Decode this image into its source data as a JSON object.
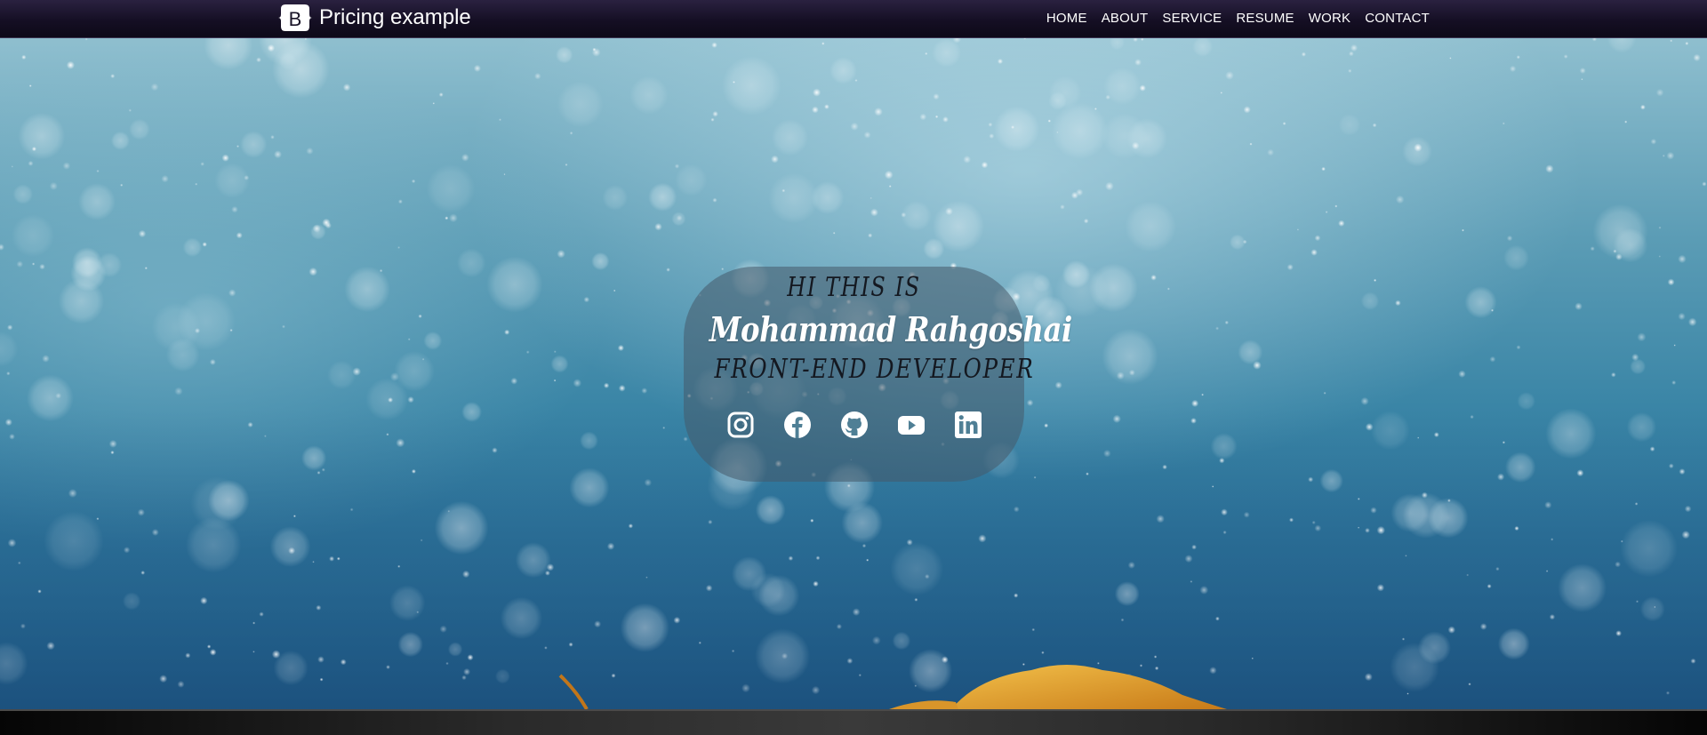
{
  "navbar": {
    "brand_text": "Pricing example",
    "brand_logo_letter": "B",
    "links": [
      {
        "label": "HOME"
      },
      {
        "label": "ABOUT"
      },
      {
        "label": "SERVICE"
      },
      {
        "label": "RESUME"
      },
      {
        "label": "WORK"
      },
      {
        "label": "CONTACT"
      }
    ]
  },
  "hero": {
    "intro": "HI THIS IS",
    "name": "Mohammad Rahgoshai",
    "role": "FRONT-END DEVELOPER",
    "socials": [
      {
        "icon": "instagram-icon"
      },
      {
        "icon": "facebook-icon"
      },
      {
        "icon": "github-icon"
      },
      {
        "icon": "youtube-icon"
      },
      {
        "icon": "linkedin-icon"
      }
    ]
  },
  "colors": {
    "navbar": "#150f24",
    "hero_sky": "#8fbfcf",
    "hero_water": "#1f5a86",
    "card": "#465a69",
    "leaf": "#e0a12a"
  }
}
